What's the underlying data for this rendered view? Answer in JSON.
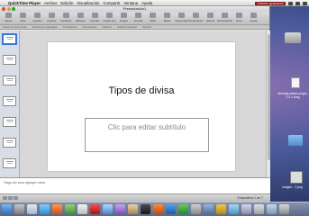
{
  "menubar": {
    "app_name": "QuickTime Player",
    "items": [
      "Archivo",
      "Edición",
      "Visualización",
      "Compartir",
      "Ventana",
      "Ayuda"
    ],
    "recording_badge": "Detener grabación"
  },
  "window": {
    "title": "Presentación1",
    "toolbar_labels": [
      "Nuevo",
      "Abrir",
      "Guardar",
      "Imprimir",
      "Deshacer",
      "Rehacer",
      "Formato",
      "Cuadro de t",
      "Imagen",
      "Formas",
      "Tabla",
      "Medio",
      "Nueva diap",
      "Presentación",
      "Galería",
      "Herramientas",
      "Zoom",
      "Ayuda"
    ],
    "ribbon_groups": [
      "Temas de documento",
      "Diseños de diapositiva",
      "Transiciones",
      "Animaciones",
      "Gráficos",
      "Gráficos SmartArt",
      "WordArt"
    ],
    "slide": {
      "title": "Tipos de divisa",
      "subtitle_placeholder": "Clic para editar subtítulo"
    },
    "notes_placeholder": "Haga clic para agregar notas",
    "slide_count": "Diapositiva 1 de 7"
  },
  "desktop": {
    "package_label": "aboutqt-adobe-plugin-2.3.1.dmg",
    "image_label": "imagen - 2.png"
  },
  "colors": {
    "accent": "#3a74d6",
    "recording": "#7a1010"
  }
}
